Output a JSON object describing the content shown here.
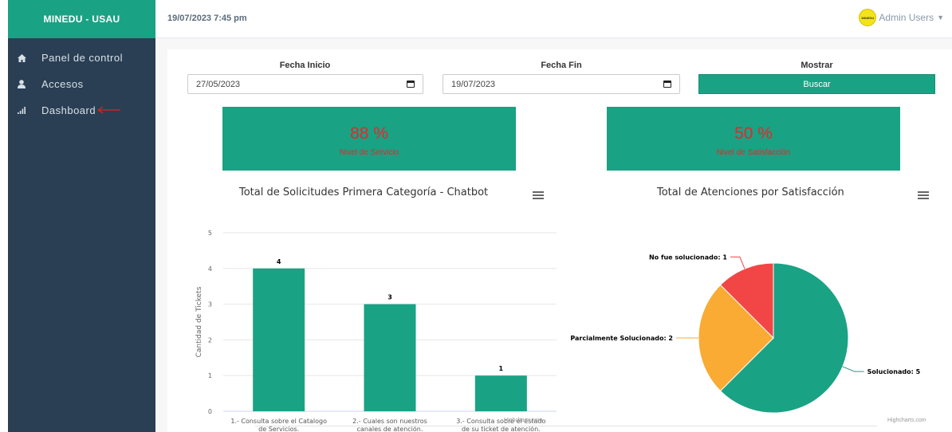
{
  "sidebar": {
    "brand": "MINEDU - USAU",
    "items": [
      {
        "label": "Panel de control",
        "icon": "home-icon"
      },
      {
        "label": "Accesos",
        "icon": "user-icon"
      },
      {
        "label": "Dashboard",
        "icon": "bar-chart-icon"
      }
    ]
  },
  "topbar": {
    "datetime": "19/07/2023 7:45 pm",
    "user": "Admin Users",
    "avatar_text": "MINEDU"
  },
  "filters": {
    "start_label": "Fecha Inicio",
    "start_value": "27/05/2023",
    "end_label": "Fecha Fin",
    "end_value": "19/07/2023",
    "show_label": "Mostrar",
    "search_button": "Buscar"
  },
  "kpis": [
    {
      "value": "88 %",
      "label": "Nivel de Servicio"
    },
    {
      "value": "50 %",
      "label": "Nivel de Satisfacción"
    }
  ],
  "colors": {
    "accent": "#1aa284",
    "sidebar": "#2a3f54",
    "kpi_text": "#e8262a",
    "pie_orange": "#f9ab34",
    "pie_red": "#f24646"
  },
  "credit": "Highcharts.com",
  "chart_data": [
    {
      "type": "bar",
      "title": "Total de Solicitudes Primera Categoría - Chatbot",
      "ylabel": "Cantidad de Tickets",
      "ylim": [
        0,
        5
      ],
      "yticks": [
        0,
        1,
        2,
        3,
        4,
        5
      ],
      "grid": true,
      "categories": [
        [
          "1.- Consulta sobre el Catalogo",
          "de Servicios."
        ],
        [
          "2.- Cuales son nuestros",
          "canales de atención."
        ],
        [
          "3.- Consulta sobre el estado",
          "de su ticket de atención."
        ]
      ],
      "values": [
        4,
        3,
        1
      ],
      "data_labels": [
        "4",
        "3",
        "1"
      ]
    },
    {
      "type": "pie",
      "title": "Total de Atenciones por Satisfacción",
      "slices": [
        {
          "name": "Solucionado",
          "value": 5,
          "label": "Solucionado: 5",
          "color": "#1aa284"
        },
        {
          "name": "Parcialmente Solucionado",
          "value": 2,
          "label": "Parcialmente Solucionado: 2",
          "color": "#f9ab34"
        },
        {
          "name": "No fue solucionado",
          "value": 1,
          "label": "No fue solucionado: 1",
          "color": "#f24646"
        }
      ]
    }
  ]
}
